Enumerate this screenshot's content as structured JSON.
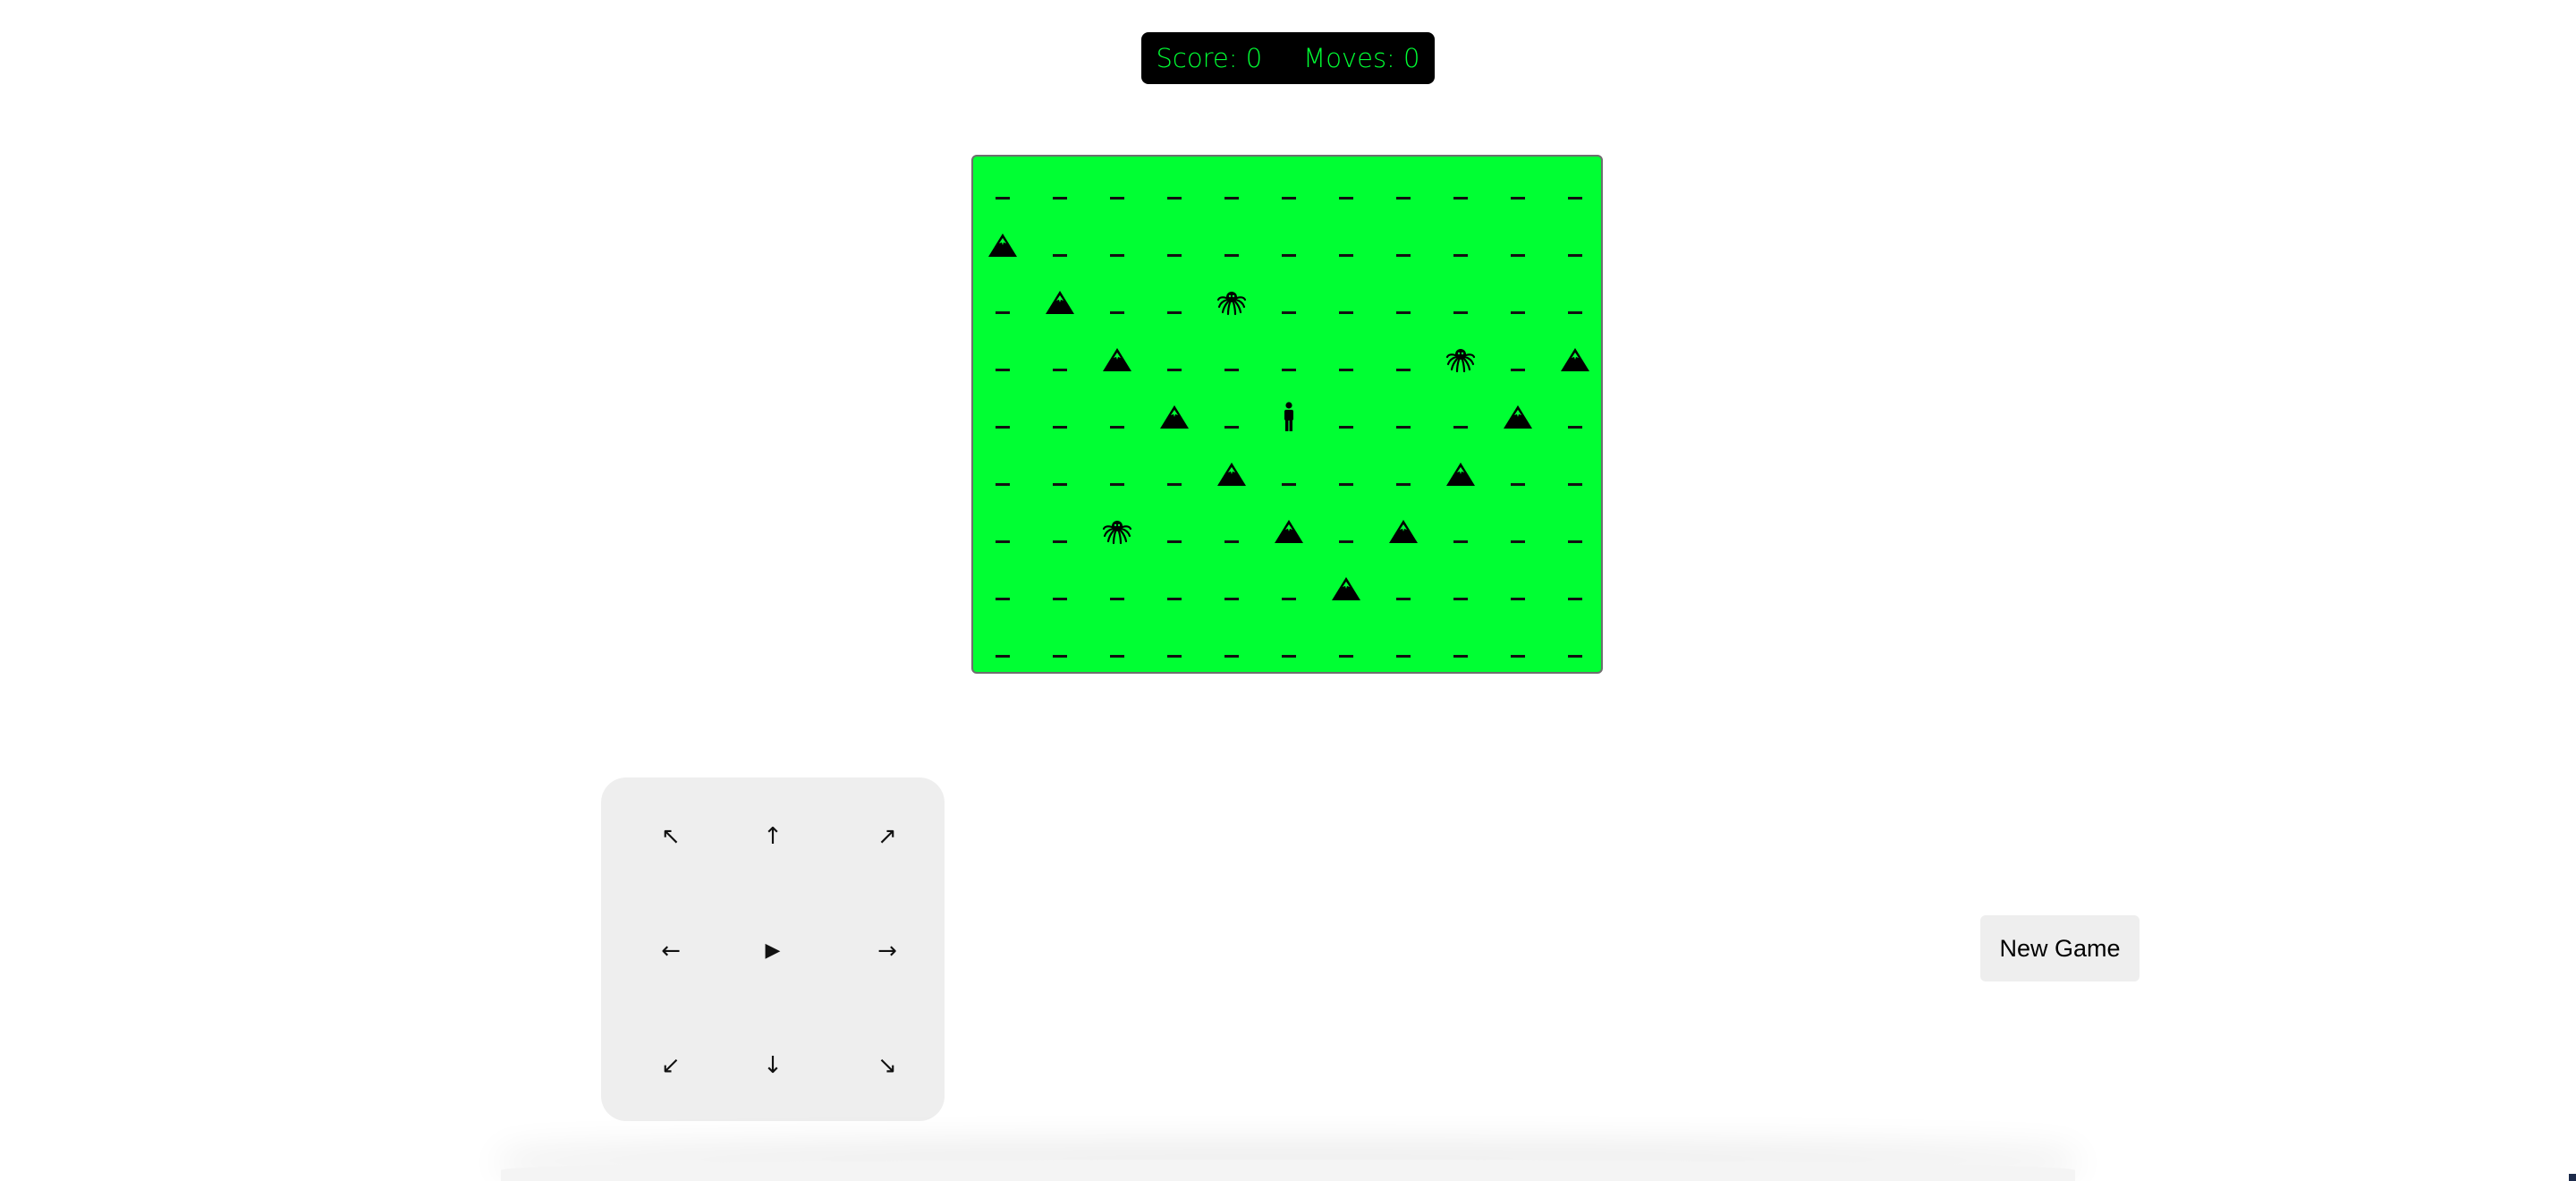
{
  "scoreboard": {
    "score_label": "Score: 0",
    "moves_label": "Moves: 0"
  },
  "board": {
    "rows": 9,
    "cols": 11,
    "background": "#00ff33",
    "empty_icon": "grass-icon",
    "player": {
      "row": 4,
      "col": 5,
      "icon": "player-icon"
    },
    "mountains": [
      [
        1,
        0
      ],
      [
        2,
        1
      ],
      [
        3,
        2
      ],
      [
        3,
        10
      ],
      [
        4,
        3
      ],
      [
        4,
        9
      ],
      [
        5,
        4
      ],
      [
        5,
        8
      ],
      [
        6,
        5
      ],
      [
        6,
        7
      ],
      [
        7,
        6
      ]
    ],
    "monsters": [
      [
        2,
        4
      ],
      [
        3,
        8
      ],
      [
        6,
        2
      ]
    ]
  },
  "controls": {
    "buttons": [
      {
        "name": "move-up-left-button",
        "icon": "arrow-up-left-icon",
        "symbol": "↖"
      },
      {
        "name": "move-up-button",
        "icon": "arrow-up-icon",
        "symbol": "↑"
      },
      {
        "name": "move-up-right-button",
        "icon": "arrow-up-right-icon",
        "symbol": "↗"
      },
      {
        "name": "move-left-button",
        "icon": "arrow-left-icon",
        "symbol": "←"
      },
      {
        "name": "wait-button",
        "icon": "play-icon",
        "symbol": "▶"
      },
      {
        "name": "move-right-button",
        "icon": "arrow-right-icon",
        "symbol": "→"
      },
      {
        "name": "move-down-left-button",
        "icon": "arrow-down-left-icon",
        "symbol": "↙"
      },
      {
        "name": "move-down-button",
        "icon": "arrow-down-icon",
        "symbol": "↓"
      },
      {
        "name": "move-down-right-button",
        "icon": "arrow-down-right-icon",
        "symbol": "↘"
      }
    ]
  },
  "new_game_label": "New Game",
  "colors": {
    "accent": "#00ff33",
    "panel": "#eeeeee",
    "scoreboard_bg": "#000000"
  }
}
